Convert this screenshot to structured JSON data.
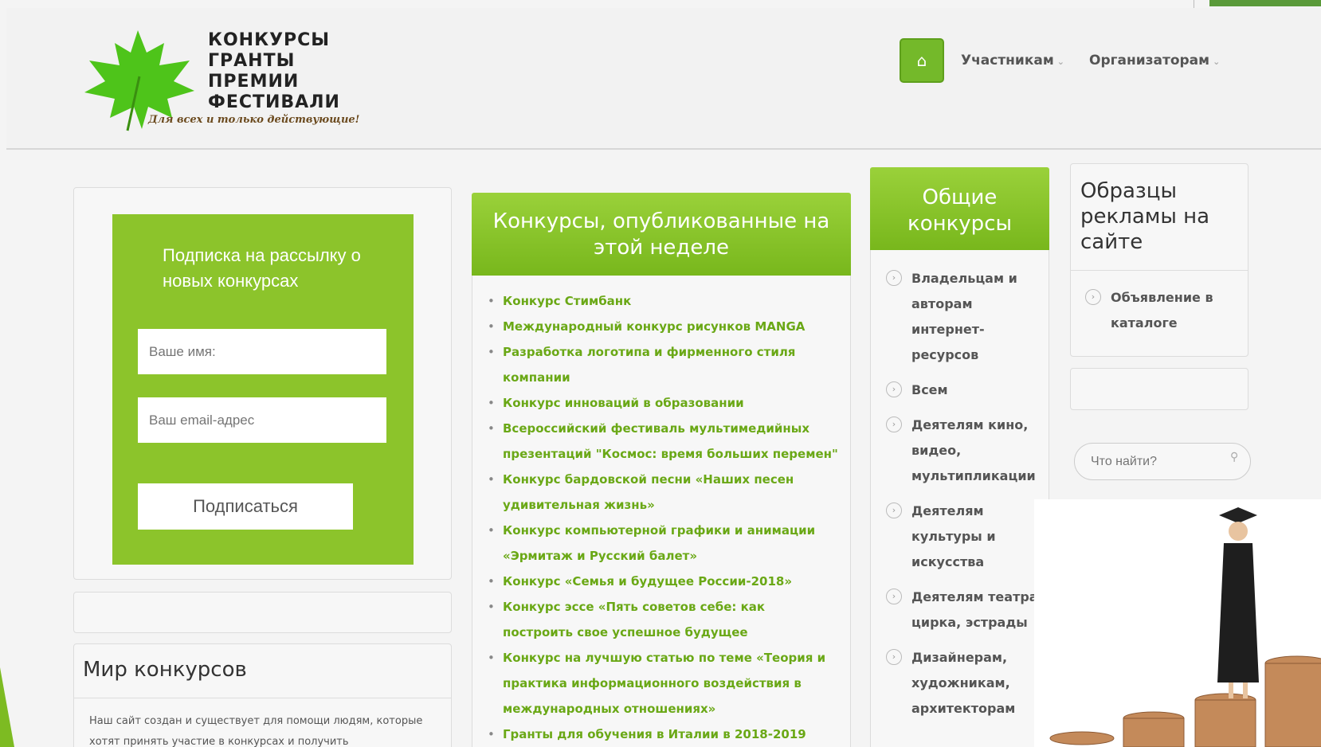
{
  "header": {
    "logo_lines": [
      "КОНКУРСЫ",
      "ГРАНТЫ",
      "ПРЕМИИ",
      "ФЕСТИВАЛИ"
    ],
    "slogan": "Для всех и только действующие!",
    "nav": [
      {
        "label": "Участникам"
      },
      {
        "label": "Организаторам"
      }
    ]
  },
  "subscribe": {
    "title": "Подписка на рассылку о новых конкурсах",
    "name_placeholder": "Ваше имя:",
    "email_placeholder": "Ваш email-адрес",
    "button_label": "Подписаться"
  },
  "world": {
    "title": "Мир конкурсов",
    "text": "Наш сайт создан и существует для помощи людям, которые хотят принять участие в конкурсах и получить"
  },
  "week": {
    "title": "Конкурсы, опубликованные на этой неделе",
    "items": [
      "Конкурс Стимбанк",
      "Международный конкурс рисунков MANGA",
      "Разработка логотипа и фирменного стиля компании",
      "Конкурс инноваций в образовании",
      "Всероссийский фестиваль мультимедийных презентаций \"Космос: время больших перемен\"",
      "Конкурс бардовской песни «Наших песен удивительная жизнь»",
      "Конкурс компьютерной графики и анимации «Эрмитаж и Русский балет»",
      "Конкурс «Семья и будущее России-2018»",
      "Конкурс эссе «Пять советов себе: как построить свое успешное будущее",
      "Конкурс на лучшую статью по теме «Теория и практика информационного воздействия в международных отношениях»",
      "Гранты для обучения в Италии в 2018-2019"
    ]
  },
  "general": {
    "title": "Общие конкурсы",
    "items": [
      "Владельцам и авторам интернет-ресурсов",
      "Всем",
      "Деятелям кино, видео, мультипликации",
      "Деятелям культуры и искусства",
      "Деятелям театра, цирка, эстрады",
      "Дизайнерам, художникам, архитекторам"
    ]
  },
  "ads": {
    "title": "Образцы рекламы на сайте",
    "item": "Объявление в каталоге"
  },
  "search": {
    "placeholder": "Что найти?"
  },
  "colors": {
    "accent_green": "#8cc42b",
    "link_green": "#6aa816"
  }
}
